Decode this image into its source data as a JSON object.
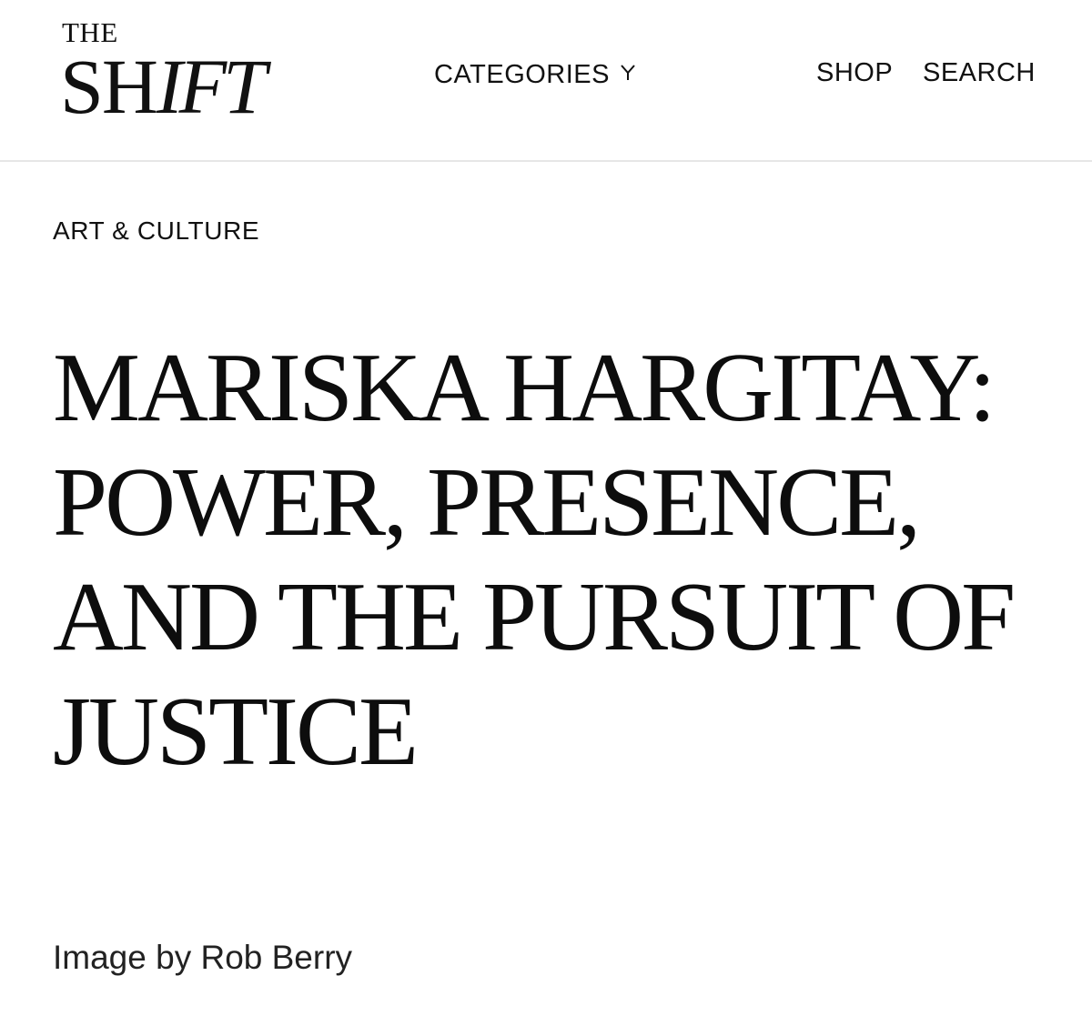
{
  "header": {
    "logo": {
      "the": "THE",
      "main_upright": "SH",
      "main_italic": "IFT"
    },
    "nav": {
      "categories_label": "CATEGORIES",
      "categories_icon": "chevron-down-icon",
      "shop_label": "SHOP",
      "search_label": "SEARCH"
    }
  },
  "article": {
    "category": "ART & CULTURE",
    "title": "MARISKA HARGITAY: POWER, PRESENCE, AND THE PURSUIT OF JUSTICE",
    "image_credit": "Image by Rob Berry"
  },
  "colors": {
    "text": "#111111",
    "divider": "#e6e6e6",
    "background": "#ffffff"
  }
}
